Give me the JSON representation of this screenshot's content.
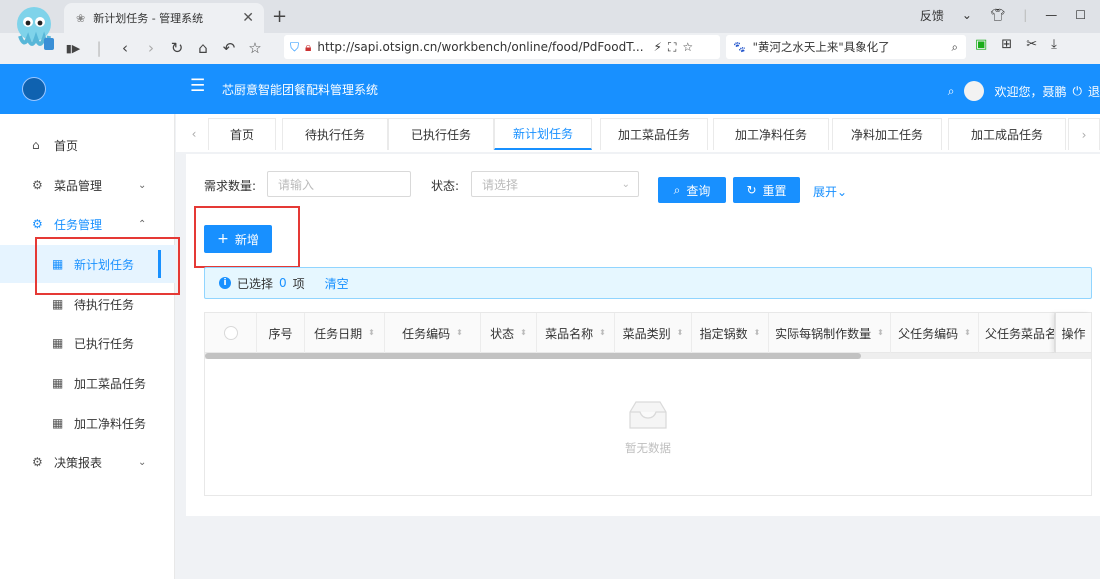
{
  "browser": {
    "tab_title": "新计划任务 - 管理系统",
    "url": "http://sapi.otsign.cn/workbench/online/food/PdFoodT...",
    "search_text": "\"黄河之水天上来\"具象化了",
    "feedback_label": "反馈"
  },
  "header": {
    "app_title": "芯厨意智能团餐配料管理系统",
    "welcome_text": "欢迎您，聂鹏",
    "logout_label": "退"
  },
  "sidebar": {
    "items": [
      {
        "label": "首页",
        "icon": "home-icon"
      },
      {
        "label": "菜品管理",
        "icon": "gear-icon"
      },
      {
        "label": "任务管理",
        "icon": "gear-icon"
      },
      {
        "label": "新计划任务",
        "icon": "grid-icon"
      },
      {
        "label": "待执行任务",
        "icon": "grid-icon"
      },
      {
        "label": "已执行任务",
        "icon": "grid-icon"
      },
      {
        "label": "加工菜品任务",
        "icon": "grid-icon"
      },
      {
        "label": "加工净料任务",
        "icon": "grid-icon"
      },
      {
        "label": "决策报表",
        "icon": "gear-icon"
      }
    ]
  },
  "tabs": [
    "首页",
    "待执行任务",
    "已执行任务",
    "新计划任务",
    "加工菜品任务",
    "加工净料任务",
    "净料加工任务",
    "加工成品任务"
  ],
  "filters": {
    "quantity_label": "需求数量:",
    "quantity_placeholder": "请输入",
    "status_label": "状态:",
    "status_placeholder": "请选择",
    "query_label": "查询",
    "reset_label": "重置",
    "expand_label": "展开"
  },
  "toolbar": {
    "add_label": "新增"
  },
  "selection": {
    "prefix": "已选择",
    "count": "0",
    "suffix": "项",
    "clear_label": "清空"
  },
  "table": {
    "columns": [
      "序号",
      "任务日期",
      "任务编码",
      "状态",
      "菜品名称",
      "菜品类别",
      "指定锅数",
      "实际每锅制作数量",
      "父任务编码",
      "父任务菜品名",
      "操作"
    ],
    "empty_text": "暂无数据"
  },
  "colors": {
    "primary": "#1890ff",
    "highlight": "#e53935"
  }
}
